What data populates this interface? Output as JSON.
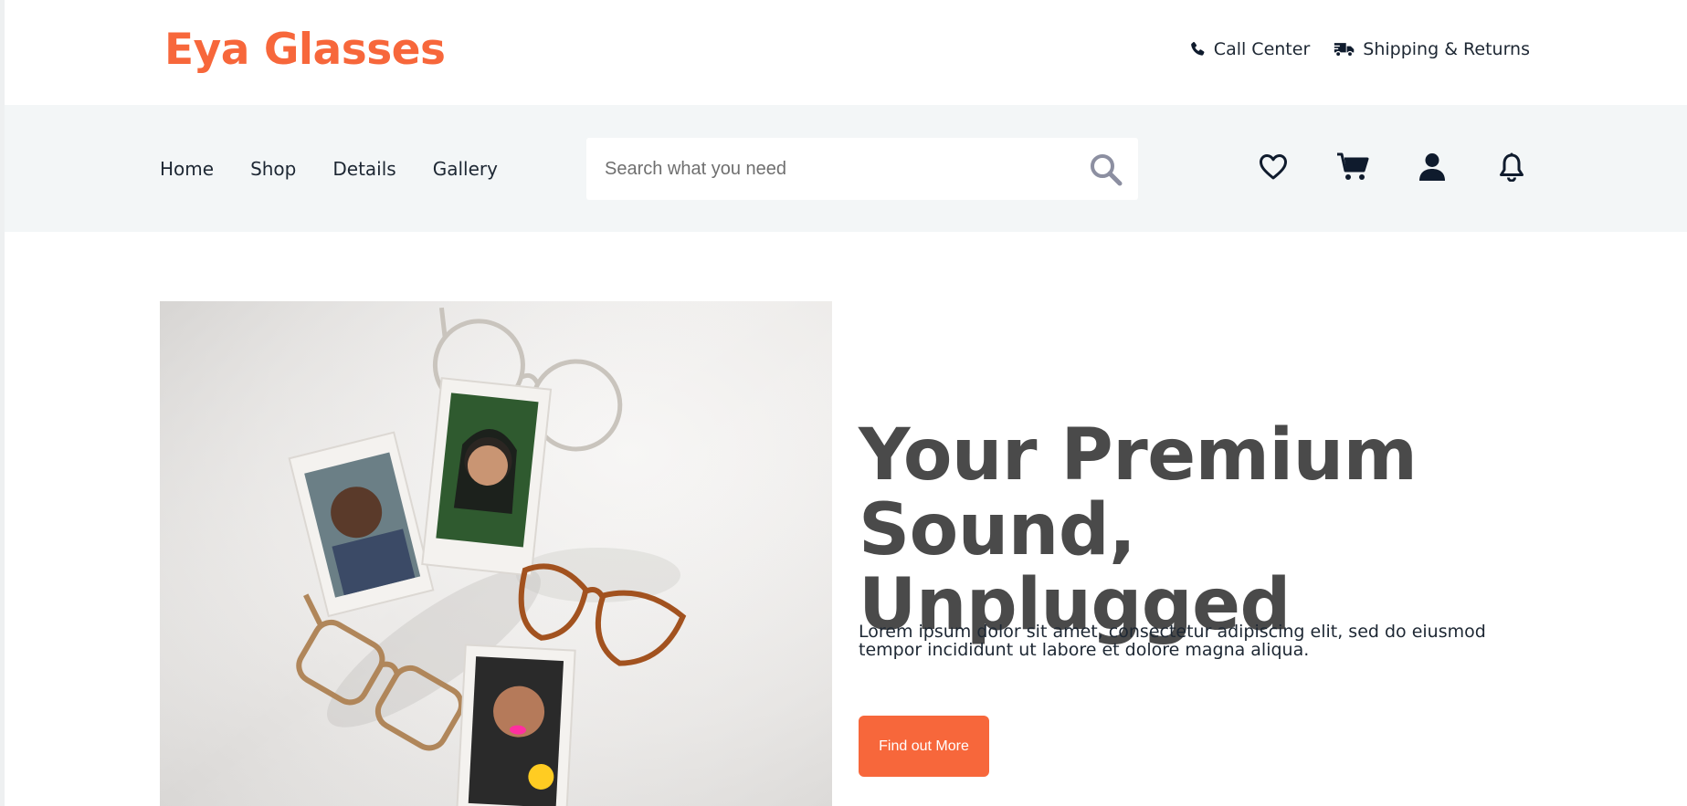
{
  "brand": {
    "name": "Eya Glasses",
    "color": "#f7673b"
  },
  "header": {
    "links": [
      {
        "label": "Call Center",
        "icon": "phone-icon"
      },
      {
        "label": "Shipping & Returns",
        "icon": "truck-icon"
      }
    ]
  },
  "nav": {
    "items": [
      {
        "label": "Home"
      },
      {
        "label": "Shop"
      },
      {
        "label": "Details"
      },
      {
        "label": "Gallery"
      }
    ],
    "search": {
      "placeholder": "Search what you need",
      "value": "",
      "icon": "search-icon"
    },
    "actions": [
      {
        "icon": "heart-icon"
      },
      {
        "icon": "cart-icon"
      },
      {
        "icon": "user-icon"
      },
      {
        "icon": "bell-icon"
      }
    ]
  },
  "hero": {
    "title": "Your Premium Sound, Unplugged",
    "text": "Lorem ipsum dolor sit amet, consectetur adipiscing elit, sed do eiusmod tempor incididunt ut labore et dolore magna aliqua.",
    "cta_label": "Find out More",
    "cta_color": "#f7673b",
    "image": "hero-glasses-photo"
  }
}
